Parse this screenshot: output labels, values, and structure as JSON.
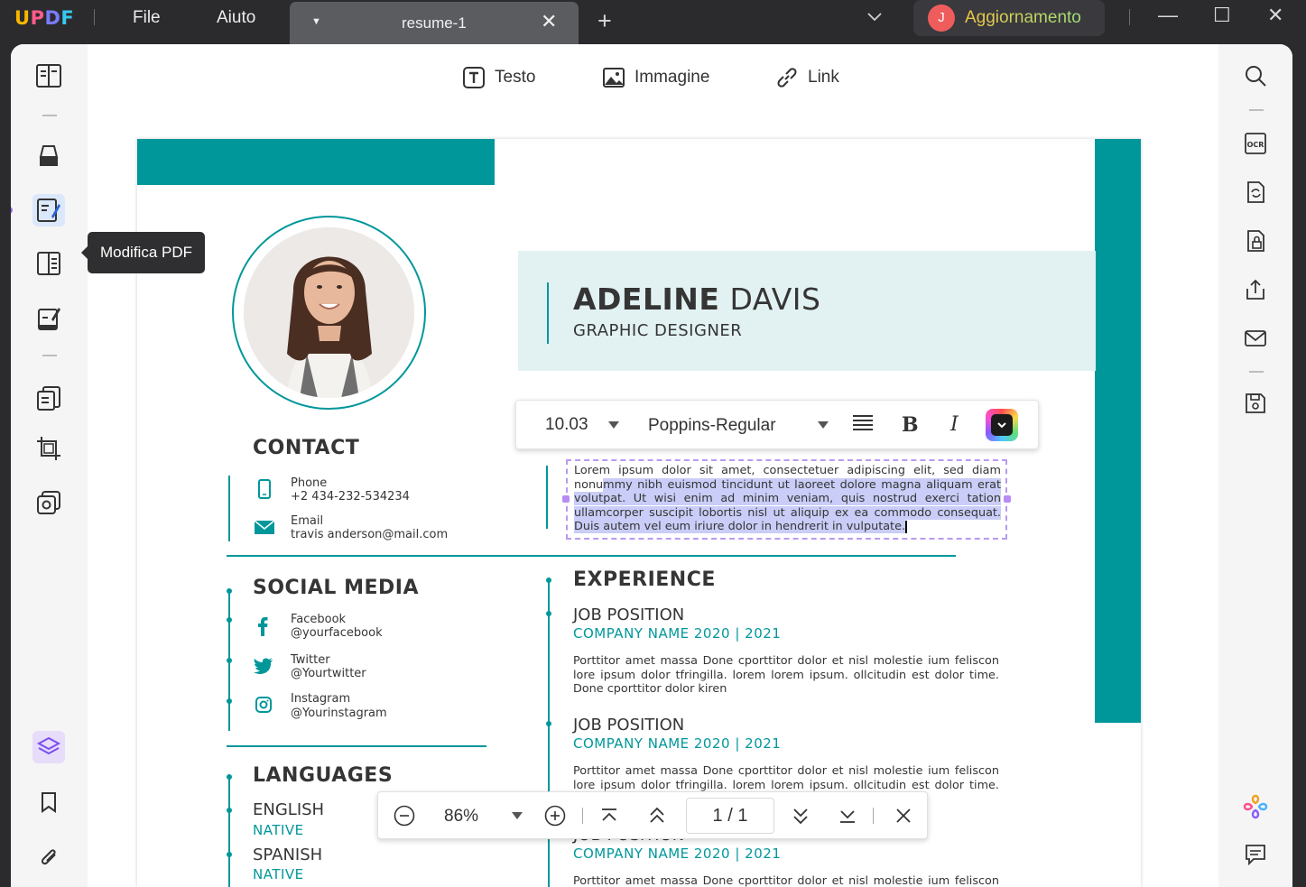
{
  "titlebar": {
    "logo": {
      "u": "U",
      "p": "P",
      "d": "D",
      "f": "F"
    },
    "menu": {
      "file": "File",
      "help": "Aiuto"
    },
    "tab": {
      "title": "resume-1",
      "close": "✕"
    },
    "new_tab": "+",
    "upgrade": {
      "avatar": "J",
      "label": "Aggiornamento"
    },
    "window": {
      "minimize": "—",
      "maximize": "☐",
      "close": "✕"
    }
  },
  "left_sidebar": {
    "tooltip": "Modifica PDF",
    "items": [
      "reader-icon",
      "highlighter-icon",
      "edit-pdf-icon",
      "page-organize-icon",
      "fill-sign-icon",
      "pages-icon",
      "crop-icon",
      "stamp-icon",
      "layers-icon",
      "bookmark-icon",
      "attachment-icon"
    ]
  },
  "edit_toolbar": {
    "text": "Testo",
    "image": "Immagine",
    "link": "Link"
  },
  "format_bar": {
    "font_size": "10.03",
    "font_name": "Poppins-Regular",
    "bold": "B",
    "italic": "I"
  },
  "resume": {
    "first_name": "ADELINE",
    "last_name": " DAVIS",
    "title": "GRAPHIC DESIGNER",
    "edit_text_before": "Lorem ipsum dolor sit amet, consectetuer adipiscing elit, sed diam nonu",
    "edit_text_selected": "mmy nibh euismod tincidunt ut laoreet dolore magna aliquam erat volutpat. Ut wisi enim ad minim veniam, quis nostrud exerci tation ullamcorper suscipit lobortis nisl ut aliquip ex ea commodo consequat. Duis autem vel eum iriure dolor in hendrerit in vulputate.",
    "contact": {
      "heading": "CONTACT",
      "phone_label": "Phone",
      "phone_value": "+2 434-232-534234",
      "email_label": "Email",
      "email_value": "travis anderson@mail.com"
    },
    "social": {
      "heading": "SOCIAL MEDIA",
      "items": [
        {
          "label": "Facebook",
          "value": "@yourfacebook"
        },
        {
          "label": "Twitter",
          "value": "@Yourtwitter"
        },
        {
          "label": "Instagram",
          "value": "@Yourinstagram"
        }
      ]
    },
    "languages": {
      "heading": "LANGUAGES",
      "items": [
        {
          "name": "ENGLISH",
          "level": "NATIVE"
        },
        {
          "name": "SPANISH",
          "level": "NATIVE"
        }
      ]
    },
    "experience": {
      "heading": "EXPERIENCE",
      "items": [
        {
          "position": "JOB POSITION",
          "company": "COMPANY NAME 2020 | 2021",
          "desc": "Porttitor amet massa Done cporttitor dolor et nisl molestie ium feliscon lore ipsum dolor tfringilla. lorem lorem ipsum. ollcitudin est dolor time. Done cporttitor dolor kiren"
        },
        {
          "position": "JOB POSITION",
          "company": "COMPANY NAME 2020 | 2021",
          "desc": "Porttitor amet massa Done cporttitor dolor et nisl molestie ium feliscon lore ipsum dolor tfringilla. lorem lorem ipsum. ollcitudin est dolor time. Done"
        },
        {
          "position": "JOB POSITION",
          "company": "COMPANY NAME 2020 | 2021",
          "desc": "Porttitor amet massa Done cporttitor dolor et nisl molestie ium feliscon lore"
        }
      ]
    }
  },
  "zoom_bar": {
    "zoom": "86%",
    "page_current": "1",
    "page_sep": "/",
    "page_total": "1"
  },
  "colors": {
    "accent": "#00979b",
    "selection": "#c9cdf7",
    "edit_border": "#b89af0"
  }
}
